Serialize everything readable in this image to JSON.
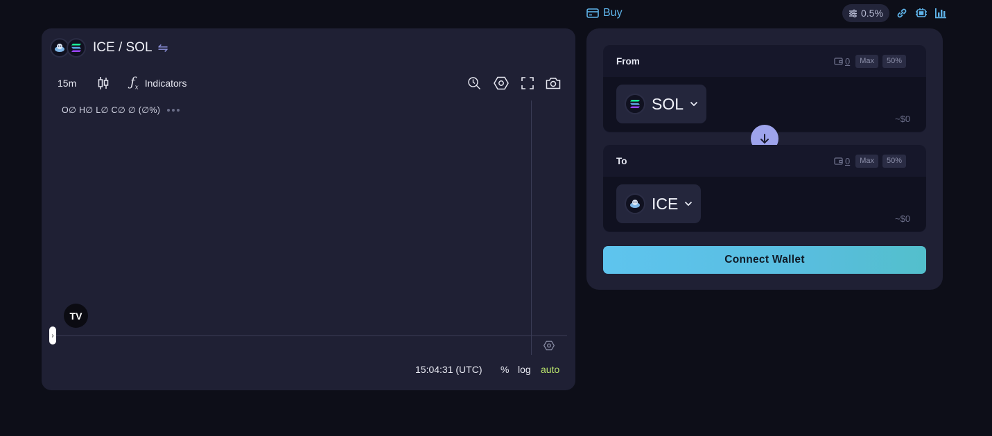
{
  "topbar": {
    "buy_label": "Buy",
    "slippage": "0.5%",
    "icons": [
      "settings-sliders-icon",
      "link-icon",
      "chip-icon",
      "bar-chart-icon"
    ]
  },
  "chart": {
    "base_symbol": "ICE",
    "quote_symbol": "SOL",
    "pair_title": "ICE / SOL",
    "interval": "15m",
    "indicators_label": "Indicators",
    "ohlc_text": "O∅ H∅ L∅ C∅ ∅ (∅%)",
    "time_readout": "15:04:31 (UTC)",
    "scale_percent": "%",
    "scale_log": "log",
    "scale_auto": "auto",
    "handle_glyph": "›",
    "tv_logo": "TV"
  },
  "swap": {
    "from": {
      "label": "From",
      "balance": "0",
      "max_label": "Max",
      "half_label": "50%",
      "token": "SOL",
      "usd_value": "~$0"
    },
    "to": {
      "label": "To",
      "balance": "0",
      "max_label": "Max",
      "half_label": "50%",
      "token": "ICE",
      "usd_value": "~$0"
    },
    "connect_label": "Connect Wallet"
  },
  "colors": {
    "background": "#0d0e18",
    "panel": "#1f2034",
    "accent_blue": "#5fb4ea",
    "flip_button": "#9ea4ec",
    "auto_scale": "#b8e36c"
  }
}
